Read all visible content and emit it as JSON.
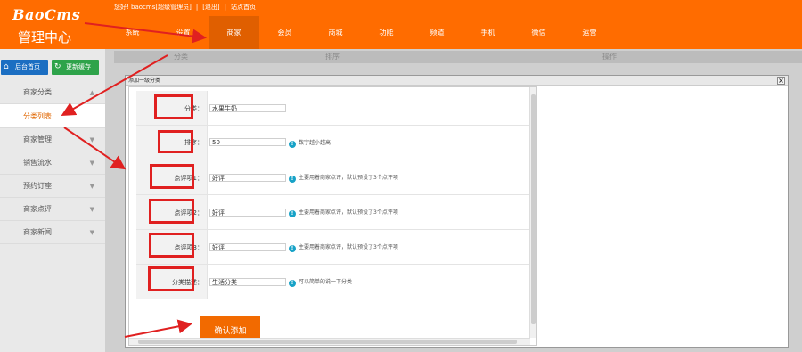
{
  "app": {
    "logo": "BaoCms",
    "center_title": "管理中心",
    "greeting": "您好! baocms[超级管理员]",
    "logout": "[退出]",
    "site_home": "站点首页"
  },
  "nav": [
    "系统",
    "设置",
    "商家",
    "会员",
    "商城",
    "功能",
    "频道",
    "手机",
    "微信",
    "运营"
  ],
  "nav_active": "商家",
  "sidebar": {
    "home_button": "后台首页",
    "refresh_button": "更新缓存",
    "items": [
      "商家分类",
      "分类列表",
      "商家管理",
      "销售流水",
      "预约订座",
      "商家点评",
      "商家新闻"
    ]
  },
  "table_header": {
    "col1": "分类",
    "col2": "排序",
    "col3": "操作"
  },
  "modal": {
    "title": "添加一级分类",
    "close": "×",
    "fields": [
      {
        "label": "分类：",
        "value": "水果牛奶",
        "hint": ""
      },
      {
        "label": "排序：",
        "value": "50",
        "hint": "数字越小越高"
      },
      {
        "label": "点评项1：",
        "value": "好评",
        "hint": "主要用着商家点评，默认预设了3个点评项"
      },
      {
        "label": "点评项2：",
        "value": "好评",
        "hint": "主要用着商家点评，默认预设了3个点评项"
      },
      {
        "label": "点评项3：",
        "value": "好评",
        "hint": "主要用着商家点评，默认预设了3个点评项"
      },
      {
        "label": "分类描述：",
        "value": "生活分类",
        "hint": "可以简单的说一下分类"
      }
    ],
    "submit": "确认添加"
  },
  "colors": {
    "brand": "#ff6c00",
    "active_nav": "#e05f00",
    "highlight": "#e02020",
    "info": "#17a2c7"
  }
}
